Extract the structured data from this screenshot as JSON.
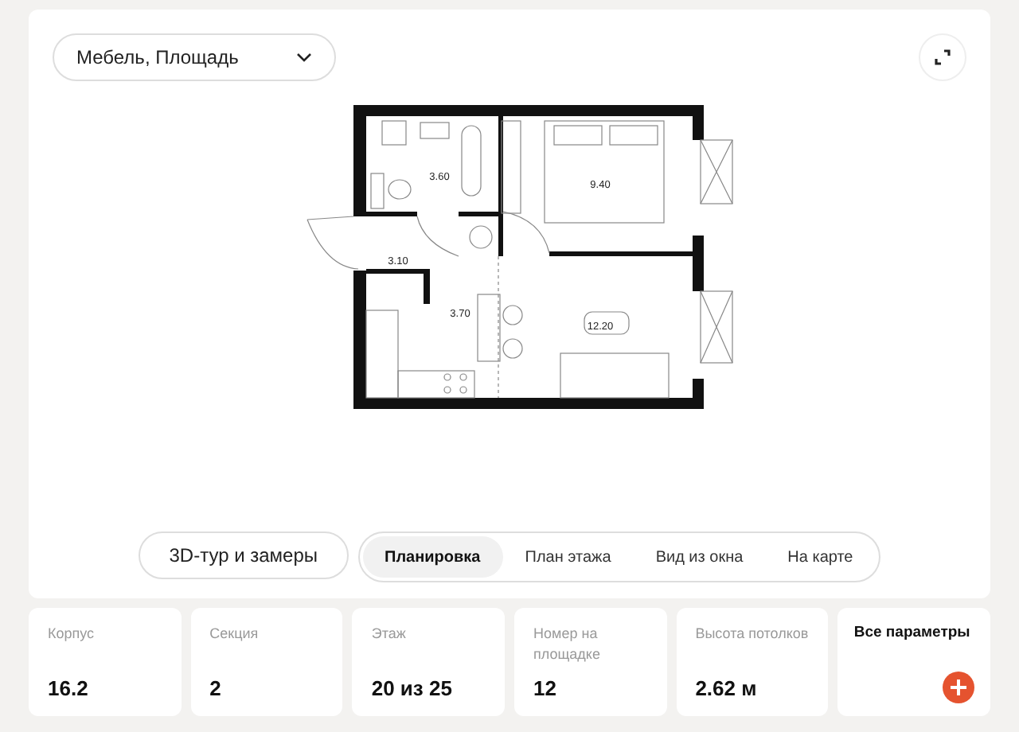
{
  "filter": {
    "value": "Мебель, Площадь"
  },
  "plan": {
    "areas": [
      {
        "label": "3.60"
      },
      {
        "label": "9.40"
      },
      {
        "label": "3.10"
      },
      {
        "label": "3.70"
      },
      {
        "label": "12.20"
      }
    ]
  },
  "secondary_button": "3D-тур и замеры",
  "tabs": [
    {
      "label": "Планировка",
      "selected": true
    },
    {
      "label": "План этажа",
      "selected": false
    },
    {
      "label": "Вид из окна",
      "selected": false
    },
    {
      "label": "На карте",
      "selected": false
    }
  ],
  "params": [
    {
      "label": "Корпус",
      "value": "16.2"
    },
    {
      "label": "Секция",
      "value": "2"
    },
    {
      "label": "Этаж",
      "value": "20 из 25"
    },
    {
      "label": "Номер на площадке",
      "value": "12"
    },
    {
      "label": "Высота потолков",
      "value": "2.62 м"
    }
  ],
  "all_params": {
    "label": "Все параметры"
  }
}
